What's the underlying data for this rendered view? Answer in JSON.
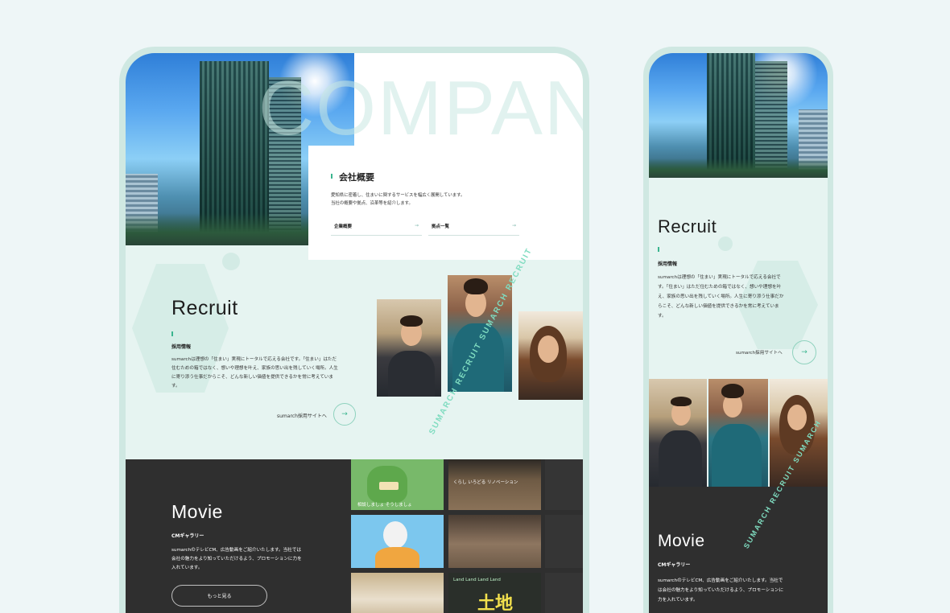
{
  "desktop": {
    "company_word": "COMPANY",
    "company_card": {
      "title": "会社概要",
      "text_line1": "愛知県に密着し、住まいに関するサービスを幅広く展開しています。",
      "text_line2": "当社の概要や拠点、沿革等を紹介します。",
      "link1": "企業概要",
      "link2": "拠点一覧",
      "arrow": "→"
    },
    "recruit": {
      "title": "Recruit",
      "subtitle": "採用情報",
      "body": [
        "sumarchは理想の「住まい」実現にトータルで応える会社です。「住まい」はただ",
        "住むための箱ではなく、想いや理想を叶え、家族の思い出を残していく場所。人生",
        "に寄り添う仕事だからこそ、どんな新しい価値を提供できるかを常に考えていま",
        "す。"
      ],
      "link": "sumarch採用サイトへ",
      "arrow": "→",
      "ring_text": "SUMARCH RECRUIT SUMARCH RECRUIT"
    },
    "movie": {
      "title": "Movie",
      "subtitle": "CMギャラリー",
      "body": [
        "sumarchのテレビCM、広告動画をご紹介いたします。当社では",
        "会社の魅力をより知っていただけるよう、プロモーションに力を",
        "入れています。"
      ],
      "button": "もっと見る",
      "thumb_texts": {
        "green": "相談しましょ そうしましょ",
        "kitchen": "くらし いろどる リノベーション",
        "sign1": "Land Land Land Land",
        "sign2": "土地"
      }
    }
  },
  "mobile": {
    "recruit": {
      "title": "Recruit",
      "subtitle": "採用情報",
      "body": [
        "sumarchは理想の「住まい」実現にトータルで応える会社で",
        "す。「住まい」はただ住むための箱ではなく、想いや理想を叶",
        "え、家族の思い出を残していく場所。人生に寄り添う仕事だか",
        "らこそ、どんな新しい価値を提供できるかを常に考えていま",
        "す。"
      ],
      "link": "sumarch採用サイトへ",
      "arrow": "→",
      "ring_text": "SUMARCH RECRUIT SUMARCH"
    },
    "movie": {
      "title": "Movie",
      "subtitle": "CMギャラリー",
      "body": [
        "sumarchのテレビCM、広告動画をご紹介いたします。当社で",
        "は会社の魅力をより知っていただけるよう、プロモーションに",
        "力を入れています。"
      ]
    }
  },
  "colors": {
    "accent": "#3bb58f",
    "mint_bg": "#e6f4f1",
    "dark": "#2f2f2f",
    "frame": "#cfe8e2"
  }
}
